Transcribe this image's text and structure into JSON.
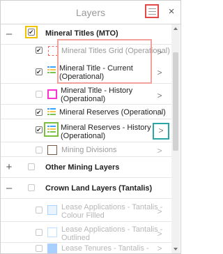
{
  "panel": {
    "title": "Layers",
    "menu_icon": "hamburger-menu-icon",
    "close_symbol": "×"
  },
  "groups": [
    {
      "label": "Mineral Titles (MTO)",
      "toggle": "–"
    },
    {
      "label": "Other Mining Layers",
      "toggle": "+"
    },
    {
      "label": "Crown Land Layers (Tantalis)",
      "toggle": "–"
    }
  ],
  "layers": [
    {
      "label": "Mineral Titles Grid (Operational)",
      "checked": true,
      "legend_icon": "dashed-red-outline-icon",
      "chevron": ">"
    },
    {
      "label_line1": "Mineral Title - Current",
      "label_line2": "(Operational)",
      "checked": true,
      "legend_icon": "multi-color-list-icon",
      "chevron": ">"
    },
    {
      "label_line1": "Mineral Title - History",
      "label_line2": "(Operational)",
      "checked": false,
      "legend_icon": "magenta-square-outline-icon",
      "chevron": ">"
    },
    {
      "label": "Mineral Reserves (Operational)",
      "checked": true,
      "legend_icon": "multi-color-list-icon",
      "chevron": ">"
    },
    {
      "label_line1": "Mineral Reserves - History",
      "label_line2": "(Operational)",
      "checked": true,
      "legend_icon": "multi-color-list-icon",
      "chevron": ">"
    },
    {
      "label": "Mining Divisions",
      "checked": false,
      "legend_icon": "brown-square-outline-icon",
      "chevron": ">"
    },
    {
      "label_line1": "Lease Applications - Tantalis -",
      "label_line2": "Colour Filled",
      "checked": false,
      "legend_icon": "light-blue-filled-square-icon",
      "chevron": ">"
    },
    {
      "label_line1": "Lease Applications - Tantalis -",
      "label_line2": "Outlined",
      "checked": false,
      "legend_icon": "light-blue-outline-square-icon",
      "chevron": ">"
    },
    {
      "label": "Lease Tenures - Tantalis - Colour",
      "checked": false,
      "legend_icon": "blue-filled-square-icon",
      "chevron": ">"
    }
  ],
  "colors": {
    "highlight_red": "#e24a4a",
    "highlight_salmon": "#f2a29a",
    "highlight_yellow": "#f3c300",
    "highlight_green": "#7bbf3a",
    "highlight_teal": "#2aa6a6",
    "highlight_magenta": "#ff2fd0"
  }
}
